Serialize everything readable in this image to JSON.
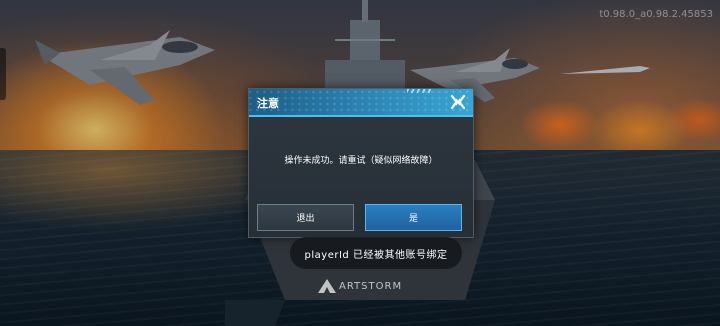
{
  "version": "t0.98.0_a0.98.2.45853",
  "dialog": {
    "title": "注意",
    "message": "操作未成功。请重试（疑似网络故障）",
    "exit_label": "退出",
    "confirm_label": "是"
  },
  "toast": {
    "text": "playerId 已经被其他账号绑定"
  },
  "logo": {
    "text": "ARTSTORM"
  },
  "colors": {
    "dialog_header": "#2a7fae",
    "confirm_button": "#1f62a0",
    "exit_button": "#2d3740"
  }
}
